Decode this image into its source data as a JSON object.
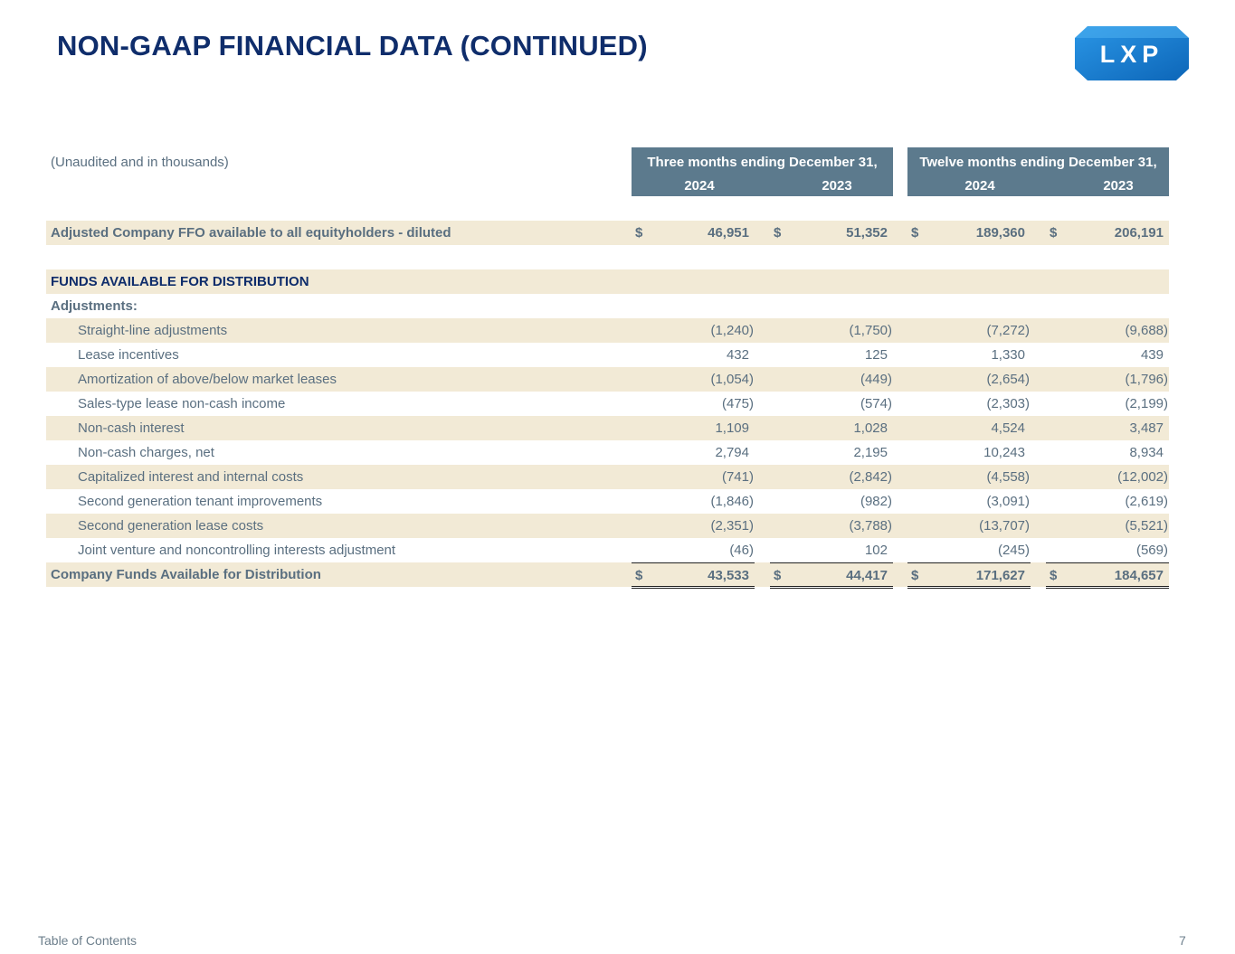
{
  "page": {
    "title": "NON-GAAP FINANCIAL DATA (CONTINUED)",
    "logo_text": "LXP",
    "footer_link": "Table of Contents",
    "page_number": "7"
  },
  "table": {
    "note": "(Unaudited and in thousands)",
    "group_three": "Three months ending December 31,",
    "group_twelve": "Twelve months ending December 31,",
    "years": [
      "2024",
      "2023",
      "2024",
      "2023"
    ],
    "adjusted_ffo": {
      "label": "Adjusted Company FFO available to all equityholders - diluted",
      "currency": [
        "$",
        "$",
        "$",
        "$"
      ],
      "values": [
        "46,951",
        "51,352",
        "189,360",
        "206,191"
      ]
    },
    "section_title": "FUNDS AVAILABLE FOR DISTRIBUTION",
    "adjustments_label": "Adjustments:",
    "adjustments": [
      {
        "label": "Straight-line adjustments",
        "values": [
          "(1,240)",
          "(1,750)",
          "(7,272)",
          "(9,688)"
        ]
      },
      {
        "label": "Lease incentives",
        "values": [
          "432",
          "125",
          "1,330",
          "439"
        ]
      },
      {
        "label": "Amortization of above/below market leases",
        "values": [
          "(1,054)",
          "(449)",
          "(2,654)",
          "(1,796)"
        ]
      },
      {
        "label": "Sales-type lease non-cash income",
        "values": [
          "(475)",
          "(574)",
          "(2,303)",
          "(2,199)"
        ]
      },
      {
        "label": "Non-cash interest",
        "values": [
          "1,109",
          "1,028",
          "4,524",
          "3,487"
        ]
      },
      {
        "label": "Non-cash charges, net",
        "values": [
          "2,794",
          "2,195",
          "10,243",
          "8,934"
        ]
      },
      {
        "label": "Capitalized interest and internal costs",
        "values": [
          "(741)",
          "(2,842)",
          "(4,558)",
          "(12,002)"
        ]
      },
      {
        "label": "Second generation tenant improvements",
        "values": [
          "(1,846)",
          "(982)",
          "(3,091)",
          "(2,619)"
        ]
      },
      {
        "label": "Second generation lease costs",
        "values": [
          "(2,351)",
          "(3,788)",
          "(13,707)",
          "(5,521)"
        ]
      },
      {
        "label": "Joint venture and noncontrolling interests adjustment",
        "values": [
          "(46)",
          "102",
          "(245)",
          "(569)"
        ]
      }
    ],
    "fad_total": {
      "label": "Company Funds Available for Distribution",
      "currency": [
        "$",
        "$",
        "$",
        "$"
      ],
      "values": [
        "43,533",
        "44,417",
        "171,627",
        "184,657"
      ]
    }
  },
  "colors": {
    "title": "#0f2d6b",
    "header_fill": "#5c7a8d",
    "shade_fill": "#f2ead6",
    "body_text": "#5a6f80",
    "logo_blue": "#1a7fd0"
  }
}
